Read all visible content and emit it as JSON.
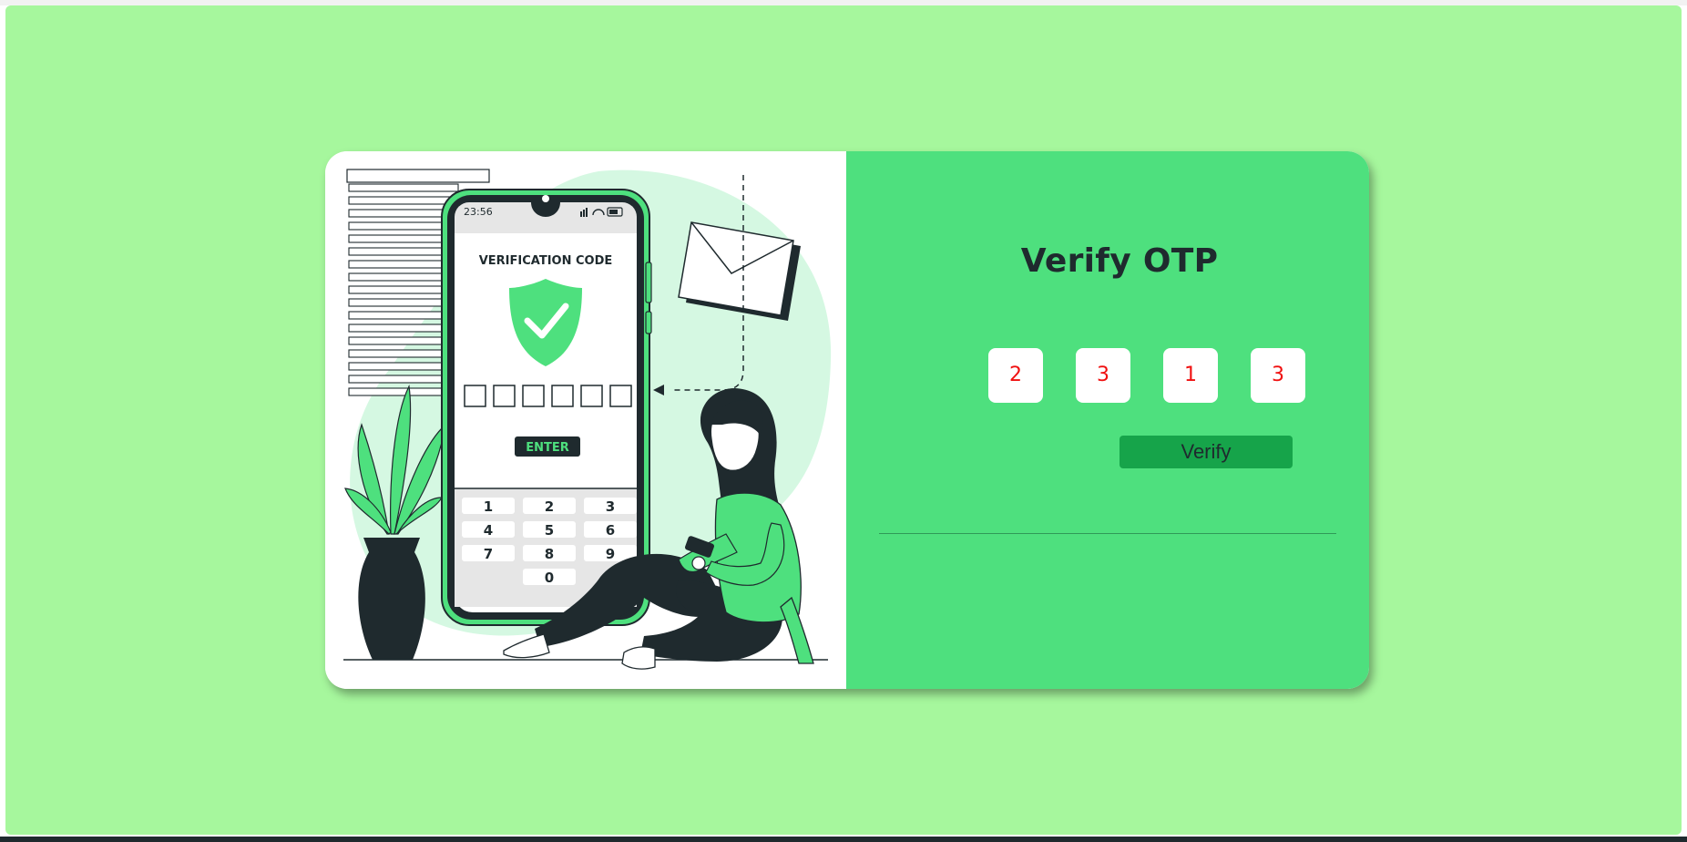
{
  "panel": {
    "title": "Verify OTP",
    "otp_digits": [
      "2",
      "3",
      "1",
      "3"
    ],
    "verify_label": "Verify"
  },
  "illustration": {
    "phone_time": "23:56",
    "heading": "VERIFICATION CODE",
    "enter_label": "ENTER",
    "keypad": [
      "1",
      "2",
      "3",
      "4",
      "5",
      "6",
      "7",
      "8",
      "9",
      "0"
    ]
  },
  "colors": {
    "page_background": "#a6f79d",
    "panel_background": "#4ee07e",
    "button_background": "#16a44a",
    "otp_digit_color": "#f01010",
    "title_color": "#1f2a2e"
  }
}
